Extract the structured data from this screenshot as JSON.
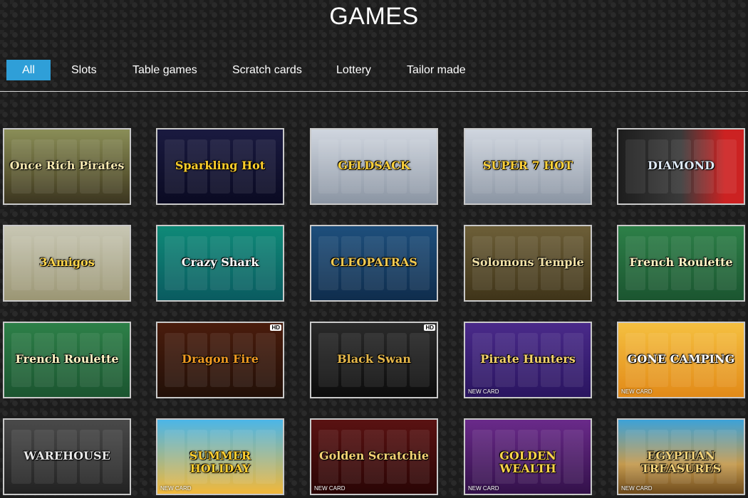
{
  "page": {
    "title": "GAMES"
  },
  "tabs": [
    {
      "label": "All",
      "active": true
    },
    {
      "label": "Slots"
    },
    {
      "label": "Table games"
    },
    {
      "label": "Scratch cards"
    },
    {
      "label": "Lottery"
    },
    {
      "label": "Tailor made"
    }
  ],
  "games": [
    {
      "name": "Once Rich Pirates",
      "style": "pirate"
    },
    {
      "name": "Sparkling Hot",
      "style": "fruits-dark"
    },
    {
      "name": "GELDSACK",
      "style": "fruits-light"
    },
    {
      "name": "SUPER 7 HOT",
      "style": "fruits-light"
    },
    {
      "name": "DIAMOND",
      "style": "diamond"
    },
    {
      "name": "3Amigos",
      "style": "amigos"
    },
    {
      "name": "Crazy Shark",
      "style": "shark"
    },
    {
      "name": "CLEOPATRAS",
      "style": "cleo"
    },
    {
      "name": "Solomons Temple",
      "style": "temple"
    },
    {
      "name": "French Roulette",
      "style": "roulette"
    },
    {
      "name": "French Roulette",
      "style": "roulette"
    },
    {
      "name": "Dragon Fire",
      "style": "dragon",
      "hd": "HD"
    },
    {
      "name": "Black Swan",
      "style": "swan",
      "hd": "HD"
    },
    {
      "name": "Pirate Hunters",
      "style": "purple",
      "sub": "NEW CARD"
    },
    {
      "name": "GONE CAMPING",
      "style": "camping",
      "sub": "NEW CARD"
    },
    {
      "name": "WAREHOUSE",
      "style": "warehouse"
    },
    {
      "name": "SUMMER HOLIDAY",
      "style": "summer",
      "sub": "NEW CARD"
    },
    {
      "name": "Golden Scratchie",
      "style": "golden",
      "sub": "NEW CARD"
    },
    {
      "name": "GOLDEN WEALTH",
      "style": "wealth",
      "sub": "NEW CARD"
    },
    {
      "name": "EGYPTIAN TREASURES",
      "style": "egypt",
      "sub": "NEW CARD"
    }
  ],
  "styles": {
    "pirate": {
      "bg": "linear-gradient(#8a8e58,#5d5a33 60%,#3b3520)",
      "color": "#f6e8b0"
    },
    "fruits-dark": {
      "bg": "linear-gradient(#1a1a40,#0a0a22)",
      "color": "#ffce2b"
    },
    "fruits-light": {
      "bg": "linear-gradient(#d0d6df,#8b95a3)",
      "color": "#ffd23b"
    },
    "diamond": {
      "bg": "linear-gradient(90deg,#1d1d1d,#3a3a3a 50%,#c22 85%)",
      "color": "#dfeaf7"
    },
    "amigos": {
      "bg": "linear-gradient(#c8c7b4,#9b9674)",
      "color": "#ffd54a"
    },
    "shark": {
      "bg": "linear-gradient(#0f8a78,#0a5b60)",
      "color": "#ffffff"
    },
    "cleo": {
      "bg": "linear-gradient(#1e4f7c,#0f2d4d)",
      "color": "#f3cb52"
    },
    "temple": {
      "bg": "linear-gradient(#6d5f38,#3f3419)",
      "color": "#f3e3a8"
    },
    "roulette": {
      "bg": "linear-gradient(#2d8048,#1b5530)",
      "color": "#fff4c4"
    },
    "dragon": {
      "bg": "linear-gradient(#4a1c0c,#221008)",
      "color": "#f09b22"
    },
    "swan": {
      "bg": "linear-gradient(#2a2a2a,#0c0c0c)",
      "color": "#e6b84a"
    },
    "purple": {
      "bg": "linear-gradient(#4a2a8a,#2a1560)",
      "color": "#f5d36c"
    },
    "camping": {
      "bg": "linear-gradient(#f5c040,#e28a18)",
      "color": "#ffffff"
    },
    "warehouse": {
      "bg": "linear-gradient(#4a4a4a,#222)",
      "color": "#e8e8e8"
    },
    "summer": {
      "bg": "linear-gradient(#4bb6e8,#f2b83a)",
      "color": "#ffcf2f"
    },
    "golden": {
      "bg": "linear-gradient(#5a1212,#2a0505)",
      "color": "#f4d273"
    },
    "wealth": {
      "bg": "linear-gradient(#6a2a8a,#33114a)",
      "color": "#ffd54a"
    },
    "egypt": {
      "bg": "linear-gradient(#3da2d8,#c49a4e 60%,#6f4b1c)",
      "color": "#f5d47a"
    }
  }
}
